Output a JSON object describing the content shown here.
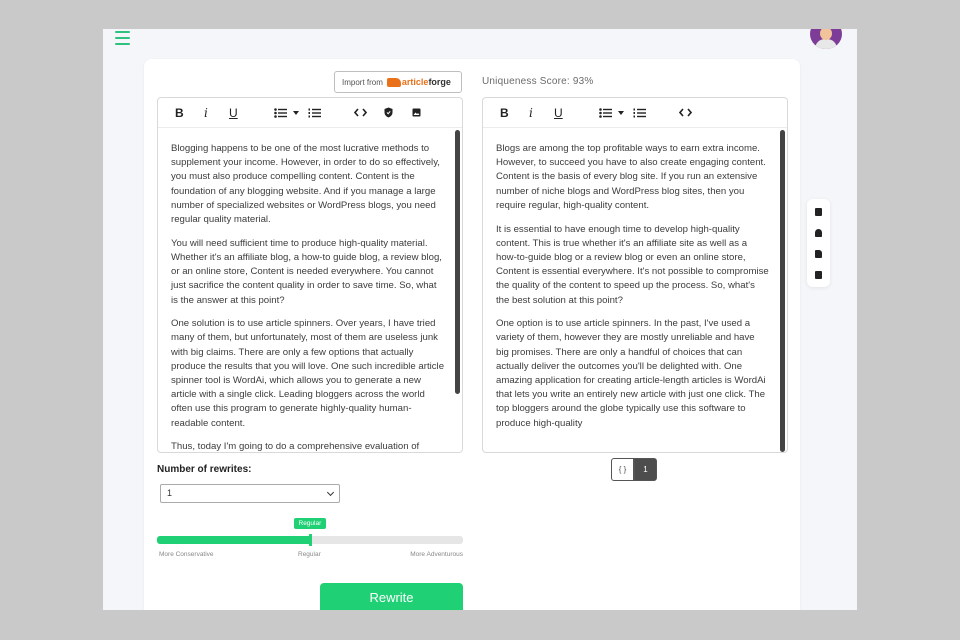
{
  "header": {
    "menu_icon": "hamburger-icon",
    "avatar_icon": "user-avatar"
  },
  "import": {
    "label": "Import from",
    "brand_part1": "article",
    "brand_part2": "forge"
  },
  "uniqueness": {
    "label": "Uniqueness Score: 93%"
  },
  "toolbar": {
    "bold": "B",
    "italic": "i",
    "underline": "U",
    "icons": [
      "bullet-list-icon",
      "dropdown-caret-icon",
      "numbered-list-icon",
      "code-icon",
      "shield-icon",
      "image-icon"
    ]
  },
  "source": {
    "paragraphs": [
      "Blogging happens to be one of the most lucrative methods to supplement your income. However, in order to do so effectively, you must also produce compelling content. Content is the foundation of any blogging website. And if you manage a large number of specialized websites or WordPress blogs, you need regular quality material.",
      "You will need sufficient time to produce high-quality material. Whether it's an affiliate blog, a how-to guide blog, a review blog, or an online store, Content is needed everywhere. You cannot just sacrifice the content quality in order to save time. So, what is the answer at this point?",
      "One solution is to use article spinners. Over years, I have tried many of them, but unfortunately, most of them are useless junk with big claims. There are only a few options that actually produce the results that you will love. One such incredible article spinner tool is WordAi, which allows you to generate a new article with a single click. Leading bloggers across the world often use this program to generate highly-quality human-readable content.",
      "Thus, today I'm going to do a comprehensive evaluation of"
    ]
  },
  "output": {
    "paragraphs": [
      "Blogs are among the top profitable ways to earn extra income. However, to succeed you have to also create engaging content. Content is the basis of every blog site. If you run an extensive number of niche blogs and WordPress blog sites, then you require regular, high-quality content.",
      "It is essential to have enough time to develop high-quality content. This is true whether it's an affiliate site as well as a how-to-guide blog or a review blog or even an online store, Content is essential everywhere. It's not possible to compromise the quality of the content to speed up the process. So, what's the best solution at this point?",
      "One option is to use article spinners. In the past, I've used a variety of them, however they are mostly unreliable and have big promises. There are only a handful of choices that can actually deliver the outcomes you'll be delighted with. One amazing application for creating article-length articles is WordAi that lets you write an entirely new article with just one click. The top bloggers around the globe typically use this software to produce high-quality"
    ]
  },
  "pager": {
    "code_label": "{ }",
    "page_label": "1"
  },
  "settings": {
    "rewrites_label": "Number of rewrites:",
    "rewrites_value": "1",
    "slider_tip": "Regular",
    "slider_value": 0.5,
    "tick_left": "More Conservative",
    "tick_mid": "Regular",
    "tick_right": "More Adventurous",
    "rewrite_button": "Rewrite"
  },
  "side_tools": [
    "clipboard-icon",
    "bell-icon",
    "document-icon",
    "save-icon"
  ],
  "colors": {
    "accent": "#1fd074",
    "brand_orange": "#e8711a",
    "page_bg": "#f4f6f9"
  }
}
